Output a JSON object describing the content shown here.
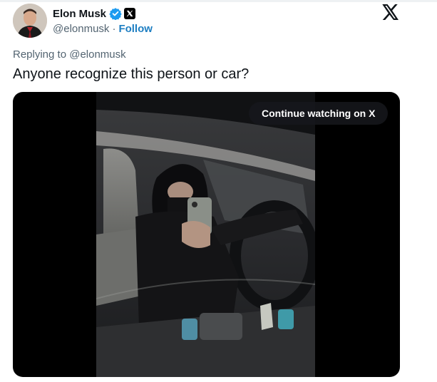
{
  "author": {
    "display_name": "Elon Musk",
    "handle": "@elonmusk",
    "separator": "·",
    "follow_label": "Follow",
    "verified_color": "#1d9bf0",
    "avatar_icon": "profile-photo"
  },
  "platform": {
    "logo_icon": "x-logo-icon"
  },
  "tweet": {
    "replying_to": "Replying to @elonmusk",
    "text": "Anyone recognize this person or car?"
  },
  "media": {
    "type": "video",
    "cta_label": "Continue watching on X",
    "icon": "video-thumbnail"
  },
  "colors": {
    "text_primary": "#0f1419",
    "text_secondary": "#536471",
    "link": "#1d7ec2",
    "media_background": "#000000"
  }
}
